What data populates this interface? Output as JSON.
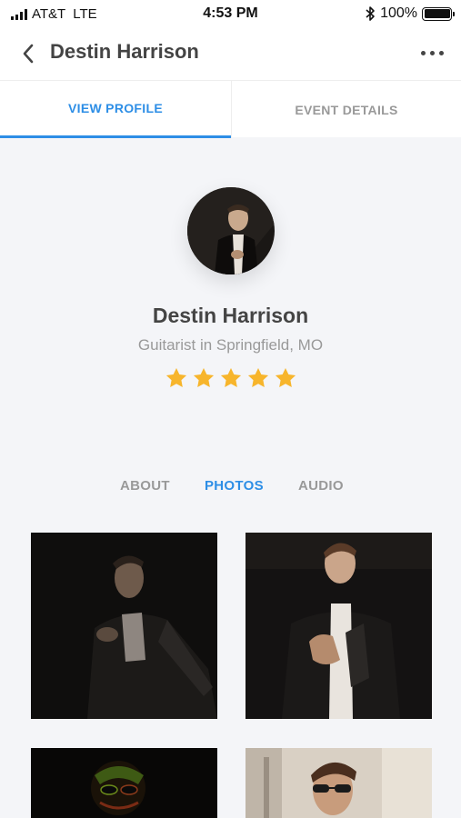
{
  "status_bar": {
    "carrier": "AT&T",
    "network": "LTE",
    "time": "4:53 PM",
    "battery_percent": "100%"
  },
  "nav": {
    "title": "Destin Harrison",
    "back_icon": "chevron-left-icon",
    "more_icon": "more-horizontal-icon"
  },
  "tabs": [
    {
      "label": "VIEW PROFILE",
      "active": true
    },
    {
      "label": "EVENT DETAILS",
      "active": false
    }
  ],
  "profile": {
    "name": "Destin Harrison",
    "subtitle": "Guitarist in Springfield, MO",
    "rating": 5,
    "rating_max": 5
  },
  "sub_tabs": [
    {
      "label": "ABOUT",
      "active": false
    },
    {
      "label": "PHOTOS",
      "active": true
    },
    {
      "label": "AUDIO",
      "active": false
    }
  ],
  "colors": {
    "accent": "#2d8ee6",
    "star": "#f7b52c",
    "background": "#f4f5f8"
  }
}
